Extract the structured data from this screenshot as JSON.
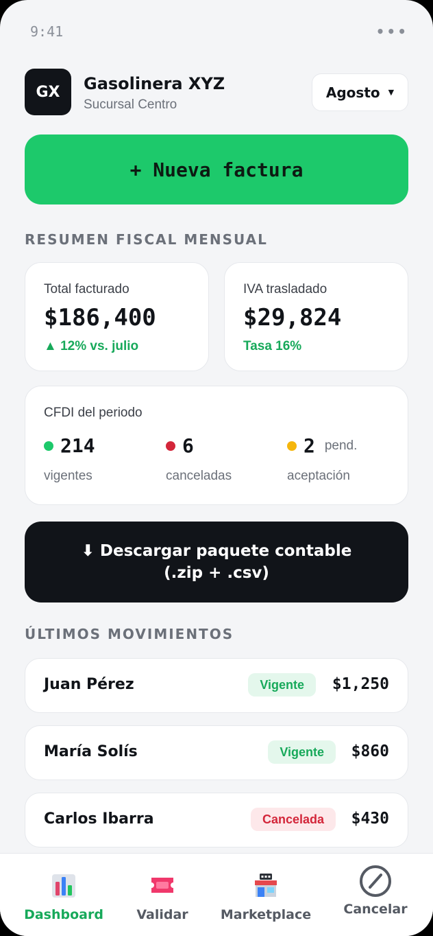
{
  "status": {
    "time": "9:41",
    "more": "•••"
  },
  "header": {
    "logo": "GX",
    "name": "Gasolinera XYZ",
    "branch": "Sucursal Centro",
    "month": "Agosto",
    "caret": "▼"
  },
  "actions": {
    "new_invoice": "+ Nueva factura",
    "download": "⬇ Descargar paquete contable (.zip + .csv)"
  },
  "summary": {
    "title": "RESUMEN FISCAL MENSUAL",
    "total": {
      "label": "Total facturado",
      "value": "$186,400",
      "delta": "▲ 12% vs. julio"
    },
    "iva": {
      "label": "IVA trasladado",
      "value": "$29,824",
      "rate": "Tasa 16%"
    },
    "cfdi": {
      "label": "CFDI del periodo",
      "items": [
        {
          "count": "214",
          "suffix": "",
          "caption": "vigentes",
          "color": "#1dc96b"
        },
        {
          "count": "6",
          "suffix": "",
          "caption": "canceladas",
          "color": "#d3263a"
        },
        {
          "count": "2",
          "suffix": "pend.",
          "caption": "aceptación",
          "color": "#f5b60c"
        }
      ]
    }
  },
  "movements": {
    "title": "ÚLTIMOS MOVIMIENTOS",
    "rows": [
      {
        "name": "Juan Pérez",
        "status": "Vigente",
        "amount": "$1,250"
      },
      {
        "name": "María Solís",
        "status": "Vigente",
        "amount": "$860"
      },
      {
        "name": "Carlos Ibarra",
        "status": "Cancelada",
        "amount": "$430"
      }
    ]
  },
  "tabs": [
    {
      "label": "Dashboard",
      "icon": "bar-chart-icon",
      "active": true
    },
    {
      "label": "Validar",
      "icon": "ticket-icon",
      "active": false
    },
    {
      "label": "Marketplace",
      "icon": "store-24h-icon",
      "active": false
    },
    {
      "label": "Cancelar",
      "icon": "cancel-circle-icon",
      "active": false
    }
  ],
  "colors": {
    "accent": "#1dc96b",
    "dark": "#111419",
    "danger": "#d3263a",
    "warning": "#f5b60c"
  }
}
